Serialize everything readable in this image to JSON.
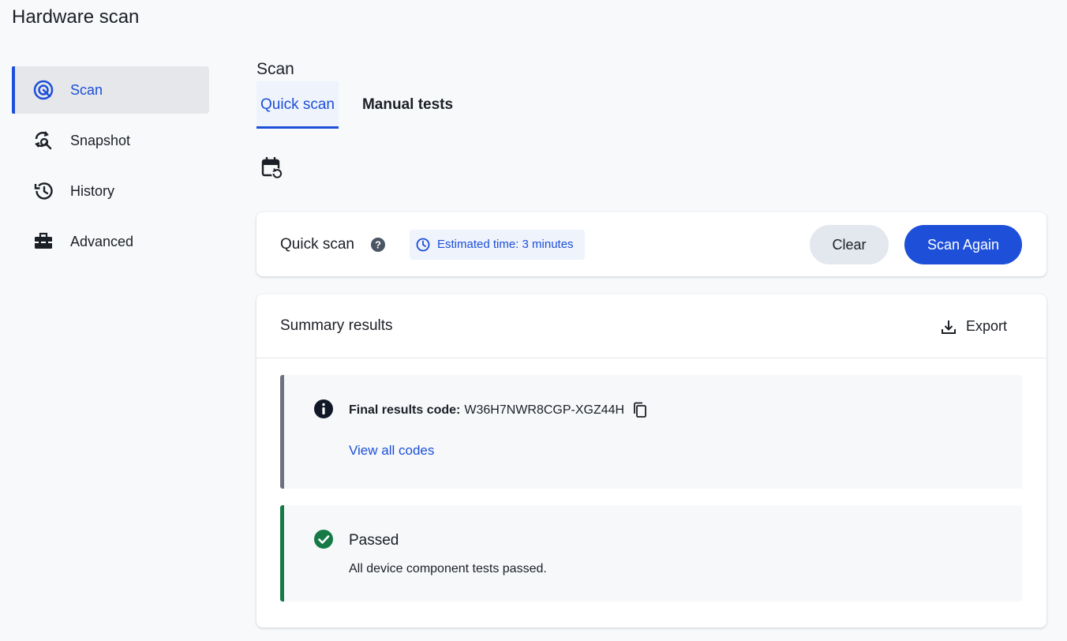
{
  "app": {
    "title": "Hardware scan"
  },
  "sidebar": {
    "items": [
      {
        "label": "Scan",
        "icon": "radar-icon",
        "active": true
      },
      {
        "label": "Snapshot",
        "icon": "snapshot-search-icon",
        "active": false
      },
      {
        "label": "History",
        "icon": "history-icon",
        "active": false
      },
      {
        "label": "Advanced",
        "icon": "toolbox-icon",
        "active": false
      }
    ]
  },
  "main": {
    "section_title": "Scan",
    "tabs": [
      {
        "label": "Quick scan",
        "active": true
      },
      {
        "label": "Manual tests",
        "active": false
      }
    ],
    "scan_card": {
      "title": "Quick scan",
      "estimate": "Estimated time: 3 minutes",
      "clear_label": "Clear",
      "scan_again_label": "Scan Again"
    },
    "summary": {
      "title": "Summary results",
      "export_label": "Export",
      "final_code_label": "Final results code:",
      "final_code_value": "W36H7NWR8CGP-XGZ44H",
      "view_all_codes": "View all codes",
      "status_title": "Passed",
      "status_description": "All device component tests passed."
    }
  },
  "colors": {
    "accent": "#1d4fd8",
    "success": "#157a46",
    "neutral_bar": "#6b7280"
  }
}
